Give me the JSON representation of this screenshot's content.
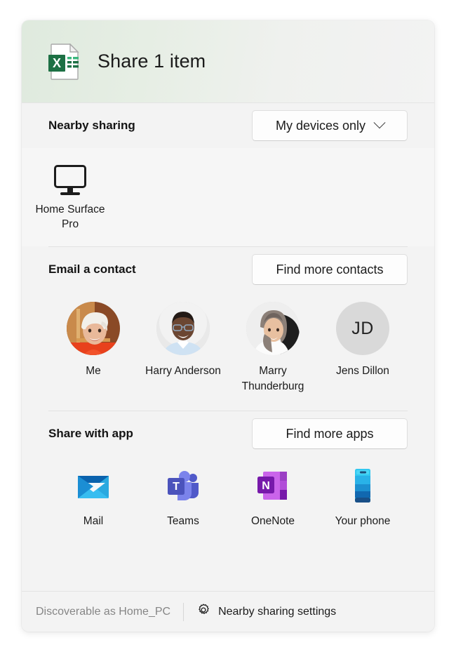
{
  "header": {
    "title": "Share 1 item",
    "file_icon": "excel-file-icon",
    "accent": "#1d7044"
  },
  "nearby": {
    "title": "Nearby sharing",
    "scope_value": "My devices only",
    "devices": [
      {
        "name": "Home Surface\nPro",
        "icon": "monitor-icon"
      }
    ]
  },
  "contacts": {
    "title": "Email a contact",
    "find_more_label": "Find more contacts",
    "items": [
      {
        "label": "Me",
        "type": "photo"
      },
      {
        "label": "Harry Anderson",
        "type": "photo"
      },
      {
        "label": "Marry\nThunderburg",
        "type": "photo"
      },
      {
        "label": "Jens Dillon",
        "type": "initials",
        "initials": "JD"
      }
    ]
  },
  "apps": {
    "title": "Share with app",
    "find_more_label": "Find more apps",
    "items": [
      {
        "label": "Mail",
        "icon": "mail-icon"
      },
      {
        "label": "Teams",
        "icon": "teams-icon"
      },
      {
        "label": "OneNote",
        "icon": "onenote-icon"
      },
      {
        "label": "Your phone",
        "icon": "phone-icon"
      }
    ]
  },
  "footer": {
    "discoverable_text": "Discoverable as Home_PC",
    "settings_label": "Nearby sharing settings",
    "settings_icon": "gear-icon"
  }
}
